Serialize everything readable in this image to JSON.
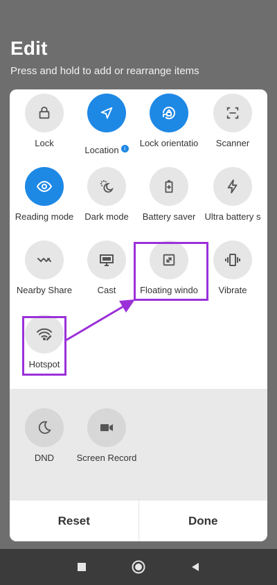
{
  "header": {
    "title": "Edit",
    "subtitle": "Press and hold to add or rearrange items"
  },
  "active_tiles": [
    {
      "label": "Lock",
      "icon": "lock-icon",
      "active": false
    },
    {
      "label": "Location",
      "icon": "location-arrow-icon",
      "active": true,
      "info_badge": "i"
    },
    {
      "label": "Lock orientatio",
      "icon": "rotation-lock-icon",
      "active": true
    },
    {
      "label": "Scanner",
      "icon": "scanner-icon",
      "active": false
    },
    {
      "label": "Reading mode",
      "icon": "eye-icon",
      "active": true
    },
    {
      "label": "Dark mode",
      "icon": "moon-sun-icon",
      "active": false
    },
    {
      "label": "Battery saver",
      "icon": "battery-plus-icon",
      "active": false
    },
    {
      "label": "Ultra battery s",
      "icon": "lightning-icon",
      "active": false
    },
    {
      "label": "Nearby Share",
      "icon": "nearby-share-icon",
      "active": false
    },
    {
      "label": "Cast",
      "icon": "cast-monitor-icon",
      "active": false
    },
    {
      "label": "Floating windo",
      "icon": "floating-window-icon",
      "active": false
    },
    {
      "label": "Vibrate",
      "icon": "vibrate-icon",
      "active": false
    },
    {
      "label": "Hotspot",
      "icon": "hotspot-icon",
      "active": false
    }
  ],
  "available_tiles": [
    {
      "label": "DND",
      "icon": "moon-icon"
    },
    {
      "label": "Screen Record",
      "icon": "video-camera-icon"
    }
  ],
  "footer": {
    "reset_label": "Reset",
    "done_label": "Done"
  },
  "navbar": {
    "items": [
      "recents-square-icon",
      "home-circle-icon",
      "back-triangle-icon"
    ]
  },
  "colors": {
    "accent": "#1e88e5",
    "highlight": "#9b30d9",
    "background": "#6e6e6e"
  }
}
